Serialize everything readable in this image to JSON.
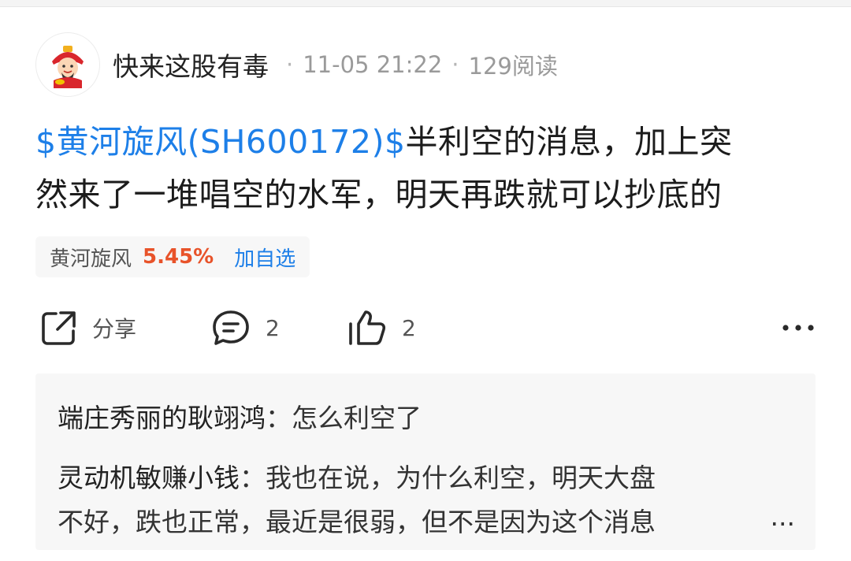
{
  "post": {
    "author": "快来这股有毒",
    "separator": "·",
    "date": "11-05 21:22",
    "reads": "129阅读",
    "stock_mention": "$黄河旋风(SH600172)$",
    "text_line1_rest": "半利空的消息，加上突",
    "text_line2": "然来了一堆唱空的水军，明天再跌就可以抄底的"
  },
  "stock_chip": {
    "name": "黄河旋风",
    "change": "5.45%",
    "add_label": "加自选"
  },
  "actions": {
    "share_label": "分享",
    "comment_count": "2",
    "like_count": "2",
    "more_label": "···"
  },
  "comments": [
    {
      "user": "端庄秀丽的耿翊鸿",
      "text": "怎么利空了"
    },
    {
      "user": "灵动机敏赚小钱",
      "text": "我也在说，为什么利空，明天大盘",
      "text_cont": "不好，跌也正常，最近是很弱，但不是因为这个消息"
    }
  ],
  "comments_more": "...",
  "colors": {
    "link": "#1d7fe8",
    "up": "#e8532a"
  },
  "icons": {
    "avatar": "caishen-avatar-icon",
    "share": "share-icon",
    "comment": "comment-icon",
    "like": "thumbs-up-icon",
    "more": "more-dots-icon"
  }
}
